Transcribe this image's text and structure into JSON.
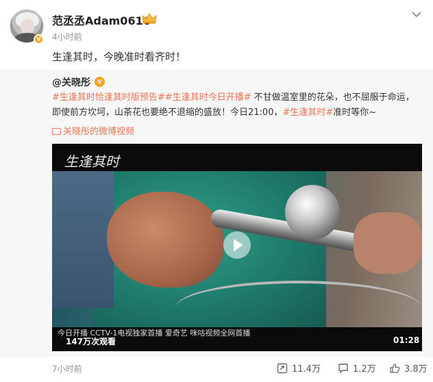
{
  "post": {
    "username": "范丞丞Adam0616",
    "time": "4小时前",
    "text": "生逢其时，今晚准时看齐时！"
  },
  "repost": {
    "author": "@关晓彤",
    "text_parts": [
      {
        "type": "tag",
        "text": "#生逢其时恰逢其时版预告#"
      },
      {
        "type": "tag",
        "text": "#生逢其时今日开播#"
      },
      {
        "type": "text",
        "text": " 不甘做温室里的花朵，也不屈服于命运，即使前方坎坷，山茶花也要绝不退缩的盛放！今日21:00，"
      },
      {
        "type": "tag",
        "text": "#生逢其时#"
      },
      {
        "type": "text",
        "text": "准时等你~"
      }
    ],
    "video_link": "关晓彤的微博视频",
    "video": {
      "title_logo": "生逢其时",
      "caption": "今日开播 CCTV-1电视独家首播 爱奇艺 咪咕视频全网首播",
      "views": "147万次观看",
      "duration": "01:28"
    },
    "time": "7小时前",
    "stats": {
      "reposts": "11.4万",
      "comments": "1.2万",
      "likes": "3.8万"
    }
  },
  "colors": {
    "accent": "#eb7350",
    "badge": "#f5a623",
    "repost_bg": "#f7f7f7"
  },
  "icons": [
    "crown-icon",
    "chevron-down-icon",
    "verified-icon",
    "video-icon",
    "play-icon",
    "repost-icon",
    "comment-icon",
    "like-icon"
  ]
}
